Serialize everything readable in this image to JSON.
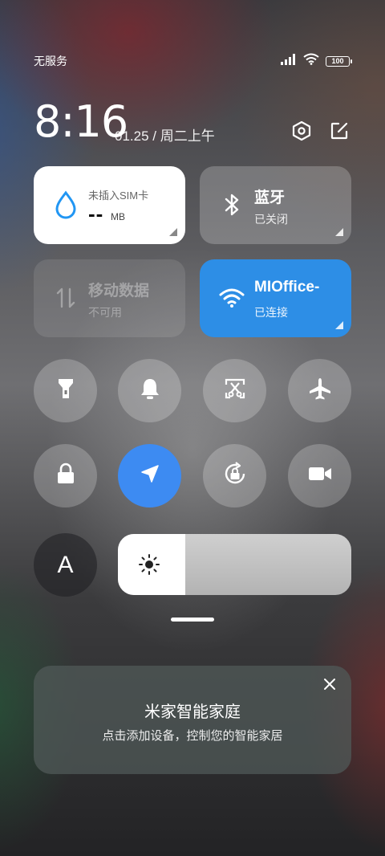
{
  "status_bar": {
    "carrier": "无服务",
    "battery": "100",
    "icons": [
      "signal-icon",
      "wifi-icon",
      "battery-icon"
    ]
  },
  "header": {
    "time": "8:16",
    "date": "01.25 / 周二上午",
    "icons": [
      "settings-icon",
      "edit-icon"
    ]
  },
  "tiles": {
    "data": {
      "sim_label": "未插入SIM卡",
      "usage": "--",
      "unit": "MB",
      "icon": "water-drop-icon"
    },
    "bluetooth": {
      "title": "蓝牙",
      "status": "已关闭",
      "icon": "bluetooth-icon"
    },
    "mobile_data": {
      "title": "移动数据",
      "status": "不可用",
      "icon": "data-arrows-icon"
    },
    "wifi": {
      "title": "MIOffice-",
      "status": "已连接",
      "icon": "wifi-icon",
      "color": "#2d8ee6"
    }
  },
  "toggles": [
    {
      "name": "flashlight",
      "icon": "flashlight-icon",
      "active": false
    },
    {
      "name": "sound",
      "icon": "bell-icon",
      "active": false
    },
    {
      "name": "screenshot",
      "icon": "scissors-icon",
      "active": false
    },
    {
      "name": "airplane",
      "icon": "airplane-icon",
      "active": false
    },
    {
      "name": "lock",
      "icon": "lock-icon",
      "active": false
    },
    {
      "name": "location",
      "icon": "location-arrow-icon",
      "active": true
    },
    {
      "name": "rotation-lock",
      "icon": "rotation-lock-icon",
      "active": false
    },
    {
      "name": "screen-record",
      "icon": "video-camera-icon",
      "active": false
    },
    {
      "name": "auto-brightness",
      "icon": "letter-a-icon",
      "label": "A",
      "active": false
    }
  ],
  "brightness": {
    "level": 0.29,
    "icon": "sun-icon"
  },
  "smart_home_card": {
    "title": "米家智能家庭",
    "subtitle": "点击添加设备，控制您的智能家居",
    "icon": "close-icon"
  },
  "colors": {
    "accent_blue": "#3d8bf2",
    "wifi_blue": "#2d8ee6"
  }
}
